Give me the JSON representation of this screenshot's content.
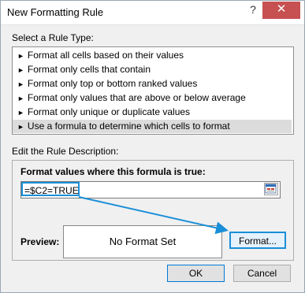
{
  "window": {
    "title": "New Formatting Rule",
    "help_label": "?",
    "close_label": "✕"
  },
  "rule_type": {
    "section_label": "Select a Rule Type:",
    "items": [
      "Format all cells based on their values",
      "Format only cells that contain",
      "Format only top or bottom ranked values",
      "Format only values that are above or below average",
      "Format only unique or duplicate values",
      "Use a formula to determine which cells to format"
    ],
    "selected_index": 5
  },
  "rule_description": {
    "section_label": "Edit the Rule Description:",
    "formula_label": "Format values where this formula is true:",
    "formula_value": "=$C2=TRUE",
    "preview_label": "Preview:",
    "preview_text": "No Format Set",
    "format_button": "Format..."
  },
  "buttons": {
    "ok": "OK",
    "cancel": "Cancel"
  },
  "colors": {
    "highlight": "#1a8fd9",
    "close_button": "#c75050",
    "selected_row": "#dcdcdc"
  },
  "icons": {
    "rule_bullet": "right-arrow-bullet-icon",
    "collapse": "collapse-dialog-icon"
  }
}
